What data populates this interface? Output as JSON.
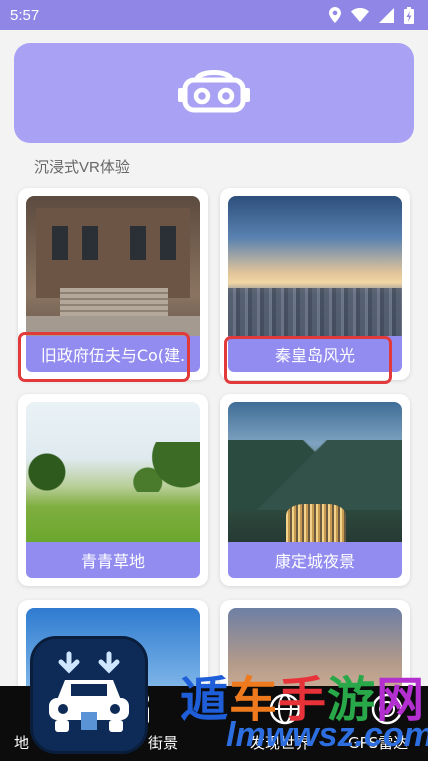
{
  "status_bar": {
    "time": "5:57",
    "icons": [
      "location-icon",
      "wifi-icon",
      "signal-icon",
      "battery-charging-icon"
    ]
  },
  "header": {
    "icon": "vr-headset-icon",
    "color": "#a9a2f4"
  },
  "section_title": "沉浸式VR体验",
  "cards": [
    {
      "label": "旧政府伍夫与Co(建.",
      "image": "old-government-building-photo",
      "highlighted": true
    },
    {
      "label": "秦皇岛风光",
      "image": "qinhuangdao-city-sunset-photo",
      "highlighted": true
    },
    {
      "label": "青青草地",
      "image": "green-meadow-photo",
      "highlighted": false
    },
    {
      "label": "康定城夜景",
      "image": "kangding-night-valley-photo",
      "highlighted": false
    },
    {
      "label": "",
      "image": "blue-sky-photo",
      "highlighted": false
    },
    {
      "label": "",
      "image": "cloudy-sky-photo",
      "highlighted": false
    }
  ],
  "bottom_nav": {
    "items": [
      {
        "label": "地",
        "icon": "map-icon"
      },
      {
        "label": "街景",
        "icon": "street-view-icon"
      },
      {
        "label": "发现世界",
        "icon": "globe-icon"
      },
      {
        "label": "GPS雷达",
        "icon": "radar-icon"
      }
    ]
  },
  "watermark": {
    "chars": [
      "遁",
      "车",
      "手",
      "游",
      "网"
    ],
    "url": "lmwwsz.com"
  },
  "colors": {
    "accent": "#8f86e6",
    "caption": "#938cf0",
    "highlight": "#e23a3a"
  }
}
